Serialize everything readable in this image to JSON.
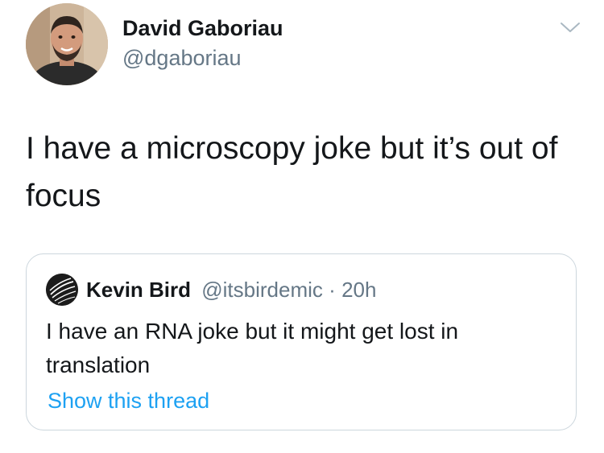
{
  "author": {
    "display_name": "David Gaboriau",
    "handle": "@dgaboriau"
  },
  "tweet": {
    "text": "I have a microscopy joke but it’s out of focus"
  },
  "quoted_tweet": {
    "display_name": "Kevin Bird",
    "handle": "@itsbirdemic",
    "separator": "·",
    "time": "20h",
    "text": "I have an RNA joke but it might get lost in translation",
    "show_thread_label": "Show this thread"
  },
  "icons": {
    "menu": "chevron-down-icon"
  },
  "colors": {
    "text_primary": "#14171a",
    "text_secondary": "#657786",
    "link": "#1da1f2",
    "border": "#ccd6dd"
  }
}
